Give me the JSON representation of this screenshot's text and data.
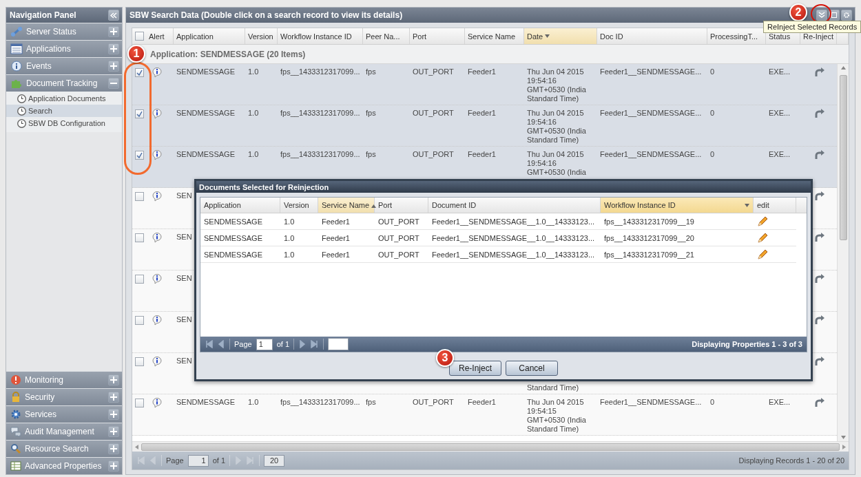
{
  "nav": {
    "title": "Navigation Panel",
    "sections": [
      {
        "label": "Server Status",
        "expanded": false
      },
      {
        "label": "Applications",
        "expanded": false
      },
      {
        "label": "Events",
        "expanded": false
      },
      {
        "label": "Document Tracking",
        "expanded": true,
        "children": [
          {
            "label": "Application Documents",
            "selected": false
          },
          {
            "label": "Search",
            "selected": true
          },
          {
            "label": "SBW DB Configuration",
            "selected": false
          }
        ]
      }
    ],
    "bottom_sections": [
      {
        "label": "Monitoring",
        "expanded": false
      },
      {
        "label": "Security",
        "expanded": false
      },
      {
        "label": "Services",
        "expanded": false
      },
      {
        "label": "Audit Management",
        "expanded": false
      },
      {
        "label": "Resource Search",
        "expanded": false
      },
      {
        "label": "Advanced Properties",
        "expanded": false
      }
    ]
  },
  "main": {
    "title": "SBW Search Data (Double click on a search record to view its details)",
    "tooltip": "ReInject Selected Records",
    "select_all": {
      "checked": false
    },
    "columns": [
      {
        "label": "Alert",
        "sorted": false
      },
      {
        "label": "Application",
        "sorted": false
      },
      {
        "label": "Version",
        "sorted": false
      },
      {
        "label": "Workflow Instance ID",
        "sorted": false
      },
      {
        "label": "Peer Na...",
        "sorted": false
      },
      {
        "label": "Port",
        "sorted": false
      },
      {
        "label": "Service Name",
        "sorted": false
      },
      {
        "label": "Date",
        "sorted": true
      },
      {
        "label": "Doc ID",
        "sorted": false
      },
      {
        "label": "ProcessingT...",
        "sorted": false
      },
      {
        "label": "Status",
        "sorted": false
      },
      {
        "label": "Re-Inject",
        "sorted": false
      }
    ],
    "group": "Application: SENDMESSAGE (20 Items)",
    "rows": [
      {
        "kind": "full",
        "checked": true,
        "cells": [
          "SENDMESSAGE",
          "1.0",
          "fps__1433312317099...",
          "fps",
          "OUT_PORT",
          "Feeder1",
          "Thu Jun 04 2015\n19:54:16\nGMT+0530 (India\nStandard Time)",
          "Feeder1__SENDMESSAGE...",
          "0",
          "EXE..."
        ]
      },
      {
        "kind": "full",
        "checked": true,
        "cells": [
          "SENDMESSAGE",
          "1.0",
          "fps__1433312317099...",
          "fps",
          "OUT_PORT",
          "Feeder1",
          "Thu Jun 04 2015\n19:54:16\nGMT+0530 (India\nStandard Time)",
          "Feeder1__SENDMESSAGE...",
          "0",
          "EXE..."
        ]
      },
      {
        "kind": "full",
        "checked": true,
        "cells": [
          "SENDMESSAGE",
          "1.0",
          "fps__1433312317099...",
          "fps",
          "OUT_PORT",
          "Feeder1",
          "Thu Jun 04 2015\n19:54:16\nGMT+0530 (India",
          "Feeder1__SENDMESSAGE...",
          "0",
          "EXE..."
        ]
      },
      {
        "kind": "covered",
        "checked": false,
        "application": "SEN"
      },
      {
        "kind": "covered",
        "checked": false,
        "application": "SEN"
      },
      {
        "kind": "covered",
        "checked": false,
        "application": "SEN"
      },
      {
        "kind": "covered",
        "checked": false,
        "application": "SEN"
      },
      {
        "kind": "covered",
        "checked": false,
        "application": "SEN",
        "date_tail": "Standard Time)"
      },
      {
        "kind": "full",
        "checked": false,
        "cells": [
          "SENDMESSAGE",
          "1.0",
          "fps__1433312317099...",
          "fps",
          "OUT_PORT",
          "Feeder1",
          "Thu Jun 04 2015\n19:54:15\nGMT+0530 (India\nStandard Time)",
          "Feeder1__SENDMESSAGE...",
          "0",
          "EXE..."
        ]
      }
    ],
    "pager": {
      "page_label": "Page",
      "page": "1",
      "of": "of 1",
      "page_size": "20",
      "summary": "Displaying Records 1 - 20 of 20"
    }
  },
  "dialog": {
    "title": "Documents Selected for Reinjection",
    "columns": [
      {
        "label": "Application",
        "sorted": false,
        "active": false
      },
      {
        "label": "Version",
        "sorted": false,
        "active": false
      },
      {
        "label": "Service Name",
        "sorted": true,
        "active": false
      },
      {
        "label": "Port",
        "sorted": false,
        "active": false
      },
      {
        "label": "Document ID",
        "sorted": false,
        "active": false
      },
      {
        "label": "Workflow Instance ID",
        "sorted": false,
        "active": true
      },
      {
        "label": "edit",
        "sorted": false,
        "active": false
      }
    ],
    "rows": [
      [
        "SENDMESSAGE",
        "1.0",
        "Feeder1",
        "OUT_PORT",
        "Feeder1__SENDMESSAGE__1.0__14333123...",
        "fps__1433312317099__19"
      ],
      [
        "SENDMESSAGE",
        "1.0",
        "Feeder1",
        "OUT_PORT",
        "Feeder1__SENDMESSAGE__1.0__14333123...",
        "fps__1433312317099__20"
      ],
      [
        "SENDMESSAGE",
        "1.0",
        "Feeder1",
        "OUT_PORT",
        "Feeder1__SENDMESSAGE__1.0__14333123...",
        "fps__1433312317099__21"
      ]
    ],
    "pager": {
      "page_label": "Page",
      "page": "1",
      "of": "of 1",
      "summary": "Displaying Properties 1 - 3 of 3"
    },
    "buttons": [
      "Re-Inject",
      "Cancel"
    ]
  },
  "callouts": [
    {
      "number": "1"
    },
    {
      "number": "2"
    },
    {
      "number": "3"
    }
  ]
}
